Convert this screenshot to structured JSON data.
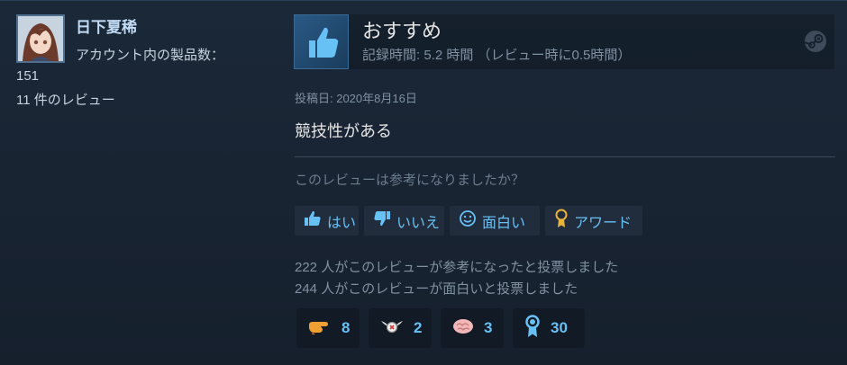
{
  "author": {
    "name": "日下夏稀",
    "product_label": "アカウント内の製品数：",
    "product_count": "151",
    "reviews_count": "11 件のレビュー"
  },
  "review": {
    "recommendation": "おすすめ",
    "hours": "記録時間: 5.2 時間 （レビュー時に0.5時間）",
    "posted": "投稿日: 2020年8月16日",
    "text": "競技性がある"
  },
  "helpful": {
    "question": "このレビューは参考になりましたか？",
    "buttons": [
      {
        "label": "はい",
        "icon": "thumbs-up-icon"
      },
      {
        "label": "いいえ",
        "icon": "thumbs-down-icon"
      },
      {
        "label": "面白い",
        "icon": "smile-icon"
      },
      {
        "label": "アワード",
        "icon": "award-ribbon-icon"
      }
    ],
    "votes_helpful": "222 人がこのレビューが参考になったと投票しました",
    "votes_funny": "244 人がこのレビューが面白いと投票しました"
  },
  "awards": [
    {
      "icon": "pointing-hand-icon",
      "count": "8"
    },
    {
      "icon": "winged-coin-icon",
      "count": "2"
    },
    {
      "icon": "brain-icon",
      "count": "3"
    },
    {
      "icon": "medal-icon",
      "count": "30"
    }
  ],
  "colors": {
    "accent": "#67c1f5",
    "background": "#1b2838",
    "muted": "#8091a2"
  }
}
